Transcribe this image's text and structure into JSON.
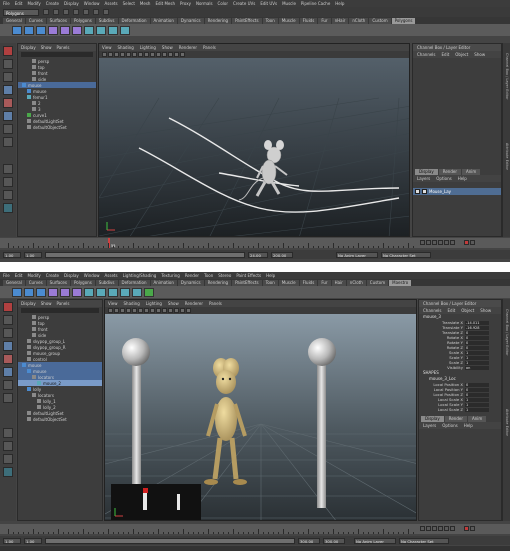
{
  "menu": [
    "File",
    "Edit",
    "Modify",
    "Create",
    "Display",
    "Window",
    "Assets",
    "Select",
    "Mesh",
    "Edit Mesh",
    "Proxy",
    "Normals",
    "Color",
    "Create UVs",
    "Edit UVs",
    "Muscle",
    "Pipeline Cache",
    "Help"
  ],
  "menu2": [
    "File",
    "Edit",
    "Modify",
    "Create",
    "Display",
    "Window",
    "Assets",
    "Lighting/Shading",
    "Texturing",
    "Render",
    "Toon",
    "Stereo",
    "Paint Effects",
    "Help"
  ],
  "mode_select": "Polygons",
  "shelf_tabs": [
    "General",
    "Curves",
    "Surfaces",
    "Polygons",
    "Subdivs",
    "Deformation",
    "Animation",
    "Dynamics",
    "Rendering",
    "PaintEffects",
    "Toon",
    "Muscle",
    "Fluids",
    "Fur",
    "nHair",
    "nCloth",
    "Custom",
    "Polygons"
  ],
  "shelf_tabs2": [
    "General",
    "Curves",
    "Surfaces",
    "Polygons",
    "Subdivs",
    "Deformation",
    "Animation",
    "Dynamics",
    "Rendering",
    "PaintEffects",
    "Toon",
    "Muscle",
    "Fluids",
    "Fur",
    "Hair",
    "nCloth",
    "Custom",
    "Maestro"
  ],
  "outliner_menu": [
    "Display",
    "Show",
    "Panels"
  ],
  "outliner1": [
    "persp",
    "top",
    "front",
    "side",
    "mouse",
    "mouse",
    "femur1",
    "2",
    "3",
    "curve1",
    "defaultLightSet",
    "defaultObjectSet"
  ],
  "outliner2": [
    "persp",
    "top",
    "front",
    "side",
    "skypop_group_L",
    "skypop_group_R",
    "mouse_group",
    "control",
    "mouse",
    "mouse",
    "locators",
    "mouse_2",
    "lolly",
    "locators",
    "lolly_1",
    "lolly_2",
    "defaultLightSet",
    "defaultObjectSet"
  ],
  "viewport_menu": [
    "View",
    "Shading",
    "Lighting",
    "Show",
    "Renderer",
    "Panels"
  ],
  "channelbox": {
    "header": "Channel Box / Layer Editor",
    "menu": [
      "Channels",
      "Edit",
      "Object",
      "Show"
    ],
    "object": "mouse_3",
    "attrs": [
      {
        "name": "Translate X",
        "value": "-14.011"
      },
      {
        "name": "Translate Y",
        "value": "-16.928"
      },
      {
        "name": "Translate Z",
        "value": "0"
      },
      {
        "name": "Rotate X",
        "value": "0"
      },
      {
        "name": "Rotate Y",
        "value": "0"
      },
      {
        "name": "Rotate Z",
        "value": "0"
      },
      {
        "name": "Scale X",
        "value": "1"
      },
      {
        "name": "Scale Y",
        "value": "1"
      },
      {
        "name": "Scale Z",
        "value": "1"
      },
      {
        "name": "Visibility",
        "value": "on"
      }
    ],
    "shapes_label": "SHAPES",
    "shape_name": "mouse_3_Loc",
    "shape_attrs": [
      {
        "name": "Local Position X",
        "value": "0"
      },
      {
        "name": "Local Position Y",
        "value": "0"
      },
      {
        "name": "Local Position Z",
        "value": "0"
      },
      {
        "name": "Local Scale X",
        "value": "1"
      },
      {
        "name": "Local Scale Y",
        "value": "1"
      },
      {
        "name": "Local Scale Z",
        "value": "1"
      }
    ]
  },
  "layer_tabs": [
    "Display",
    "Render",
    "Anim"
  ],
  "layer_menu": [
    "Layers",
    "Options",
    "Help"
  ],
  "layer_name": "Mouse_Lay",
  "side_tabs": [
    "Channel Box / Layer Editor",
    "Attribute Editor"
  ],
  "timeline1": {
    "start": "1.00",
    "end": "200.00",
    "range_start": "1.00",
    "range_end": "24.00",
    "current": "55",
    "anim_layer": "No Anim Layer",
    "char_set": "No Character Set"
  },
  "timeline2": {
    "start": "1.00",
    "end": "300.00",
    "range_start": "1.00",
    "range_end": "300.00",
    "anim_layer": "No Anim Layer",
    "char_set": "No Character Set"
  },
  "colors": {
    "accent_blue": "#4b8bd0",
    "selection": "#4a6a99",
    "ui_bg": "#444444"
  }
}
